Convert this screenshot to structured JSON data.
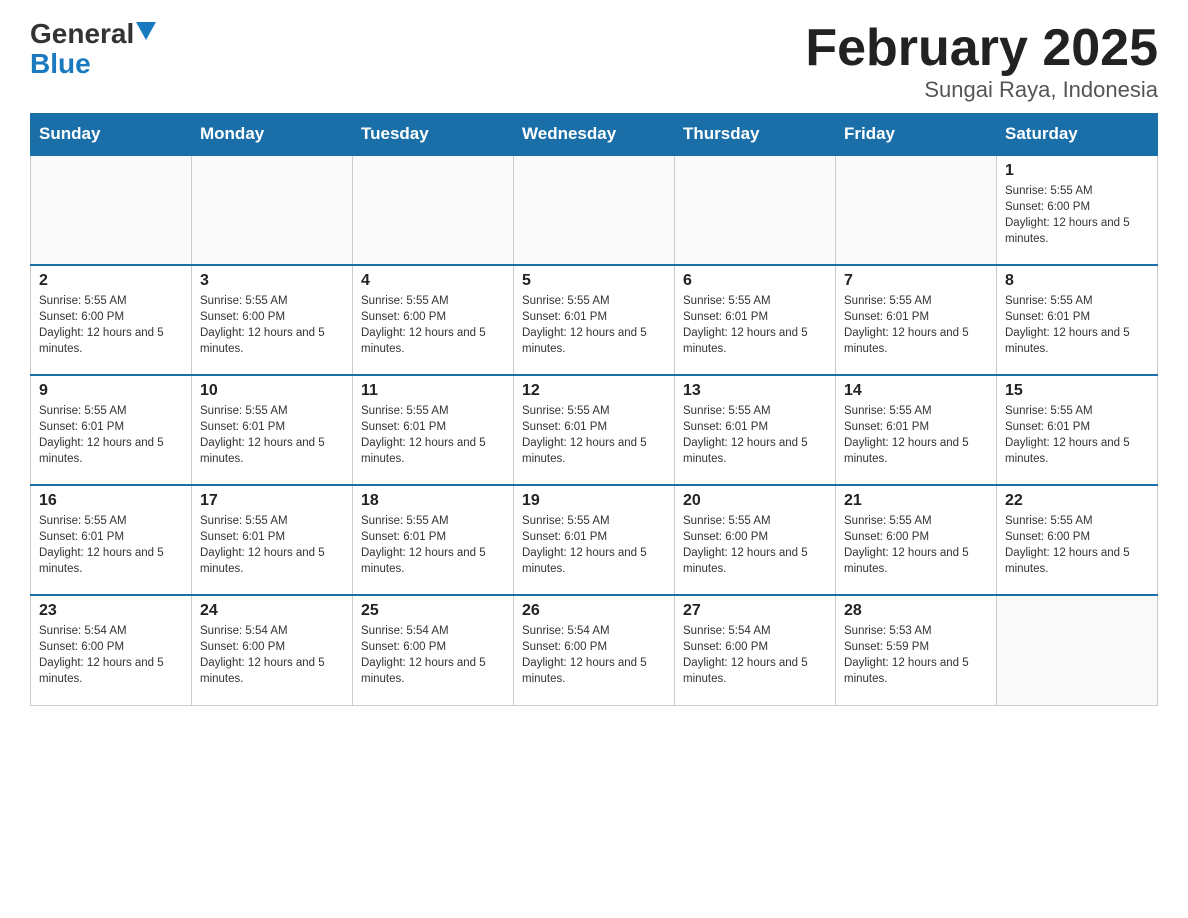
{
  "logo": {
    "general": "General",
    "blue": "Blue"
  },
  "title": "February 2025",
  "subtitle": "Sungai Raya, Indonesia",
  "days_of_week": [
    "Sunday",
    "Monday",
    "Tuesday",
    "Wednesday",
    "Thursday",
    "Friday",
    "Saturday"
  ],
  "weeks": [
    [
      {
        "day": "",
        "info": ""
      },
      {
        "day": "",
        "info": ""
      },
      {
        "day": "",
        "info": ""
      },
      {
        "day": "",
        "info": ""
      },
      {
        "day": "",
        "info": ""
      },
      {
        "day": "",
        "info": ""
      },
      {
        "day": "1",
        "info": "Sunrise: 5:55 AM\nSunset: 6:00 PM\nDaylight: 12 hours and 5 minutes."
      }
    ],
    [
      {
        "day": "2",
        "info": "Sunrise: 5:55 AM\nSunset: 6:00 PM\nDaylight: 12 hours and 5 minutes."
      },
      {
        "day": "3",
        "info": "Sunrise: 5:55 AM\nSunset: 6:00 PM\nDaylight: 12 hours and 5 minutes."
      },
      {
        "day": "4",
        "info": "Sunrise: 5:55 AM\nSunset: 6:00 PM\nDaylight: 12 hours and 5 minutes."
      },
      {
        "day": "5",
        "info": "Sunrise: 5:55 AM\nSunset: 6:01 PM\nDaylight: 12 hours and 5 minutes."
      },
      {
        "day": "6",
        "info": "Sunrise: 5:55 AM\nSunset: 6:01 PM\nDaylight: 12 hours and 5 minutes."
      },
      {
        "day": "7",
        "info": "Sunrise: 5:55 AM\nSunset: 6:01 PM\nDaylight: 12 hours and 5 minutes."
      },
      {
        "day": "8",
        "info": "Sunrise: 5:55 AM\nSunset: 6:01 PM\nDaylight: 12 hours and 5 minutes."
      }
    ],
    [
      {
        "day": "9",
        "info": "Sunrise: 5:55 AM\nSunset: 6:01 PM\nDaylight: 12 hours and 5 minutes."
      },
      {
        "day": "10",
        "info": "Sunrise: 5:55 AM\nSunset: 6:01 PM\nDaylight: 12 hours and 5 minutes."
      },
      {
        "day": "11",
        "info": "Sunrise: 5:55 AM\nSunset: 6:01 PM\nDaylight: 12 hours and 5 minutes."
      },
      {
        "day": "12",
        "info": "Sunrise: 5:55 AM\nSunset: 6:01 PM\nDaylight: 12 hours and 5 minutes."
      },
      {
        "day": "13",
        "info": "Sunrise: 5:55 AM\nSunset: 6:01 PM\nDaylight: 12 hours and 5 minutes."
      },
      {
        "day": "14",
        "info": "Sunrise: 5:55 AM\nSunset: 6:01 PM\nDaylight: 12 hours and 5 minutes."
      },
      {
        "day": "15",
        "info": "Sunrise: 5:55 AM\nSunset: 6:01 PM\nDaylight: 12 hours and 5 minutes."
      }
    ],
    [
      {
        "day": "16",
        "info": "Sunrise: 5:55 AM\nSunset: 6:01 PM\nDaylight: 12 hours and 5 minutes."
      },
      {
        "day": "17",
        "info": "Sunrise: 5:55 AM\nSunset: 6:01 PM\nDaylight: 12 hours and 5 minutes."
      },
      {
        "day": "18",
        "info": "Sunrise: 5:55 AM\nSunset: 6:01 PM\nDaylight: 12 hours and 5 minutes."
      },
      {
        "day": "19",
        "info": "Sunrise: 5:55 AM\nSunset: 6:01 PM\nDaylight: 12 hours and 5 minutes."
      },
      {
        "day": "20",
        "info": "Sunrise: 5:55 AM\nSunset: 6:00 PM\nDaylight: 12 hours and 5 minutes."
      },
      {
        "day": "21",
        "info": "Sunrise: 5:55 AM\nSunset: 6:00 PM\nDaylight: 12 hours and 5 minutes."
      },
      {
        "day": "22",
        "info": "Sunrise: 5:55 AM\nSunset: 6:00 PM\nDaylight: 12 hours and 5 minutes."
      }
    ],
    [
      {
        "day": "23",
        "info": "Sunrise: 5:54 AM\nSunset: 6:00 PM\nDaylight: 12 hours and 5 minutes."
      },
      {
        "day": "24",
        "info": "Sunrise: 5:54 AM\nSunset: 6:00 PM\nDaylight: 12 hours and 5 minutes."
      },
      {
        "day": "25",
        "info": "Sunrise: 5:54 AM\nSunset: 6:00 PM\nDaylight: 12 hours and 5 minutes."
      },
      {
        "day": "26",
        "info": "Sunrise: 5:54 AM\nSunset: 6:00 PM\nDaylight: 12 hours and 5 minutes."
      },
      {
        "day": "27",
        "info": "Sunrise: 5:54 AM\nSunset: 6:00 PM\nDaylight: 12 hours and 5 minutes."
      },
      {
        "day": "28",
        "info": "Sunrise: 5:53 AM\nSunset: 5:59 PM\nDaylight: 12 hours and 5 minutes."
      },
      {
        "day": "",
        "info": ""
      }
    ]
  ]
}
